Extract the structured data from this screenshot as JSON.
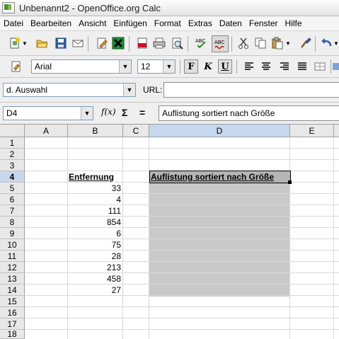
{
  "window": {
    "title": "Unbenannt2 - OpenOffice.org Calc"
  },
  "menu": [
    "Datei",
    "Bearbeiten",
    "Ansicht",
    "Einfügen",
    "Format",
    "Extras",
    "Daten",
    "Fenster",
    "Hilfe"
  ],
  "formatting": {
    "font_name": "Arial",
    "font_size": "12",
    "bold": "F",
    "italic": "K",
    "underline": "U"
  },
  "url_bar": {
    "dropdown_value": "d. Auswahl",
    "url_label": "URL:",
    "url_value": ""
  },
  "formula_bar": {
    "cell_ref": "D4",
    "function_wizard": "f(x)",
    "sum": "Σ",
    "equals": "=",
    "content": "Auflistung sortiert nach Größe"
  },
  "columns": [
    "A",
    "B",
    "C",
    "D",
    "E"
  ],
  "rows": [
    "1",
    "2",
    "3",
    "4",
    "5",
    "6",
    "7",
    "8",
    "9",
    "10",
    "11",
    "12",
    "13",
    "14",
    "15",
    "16",
    "17",
    "18"
  ],
  "cells": {
    "B4": "Entfernung",
    "D4": "Auflistung sortiert nach Größe",
    "B_values": [
      "33",
      "4",
      "111",
      "854",
      "6",
      "75",
      "28",
      "213",
      "458",
      "27"
    ]
  },
  "selection": {
    "active_cell": "D4",
    "selected_range": "D4:D14"
  },
  "colors": {
    "selection_shade": "#C9C9C9",
    "header_selected": "#C6D8EE"
  }
}
